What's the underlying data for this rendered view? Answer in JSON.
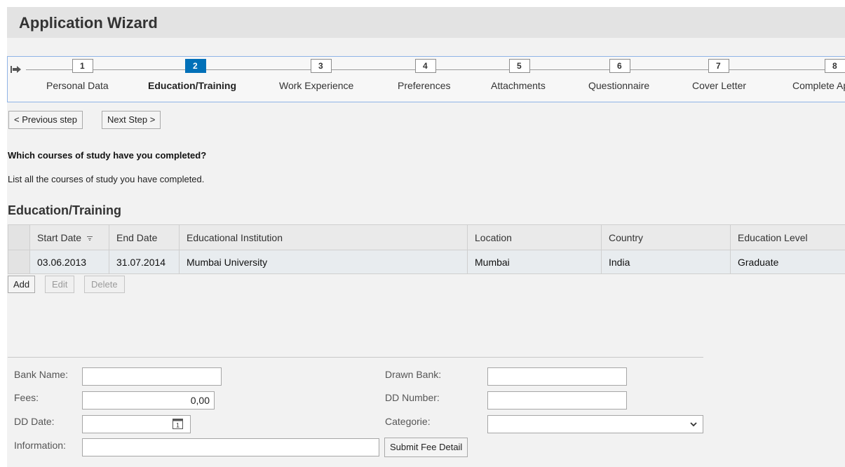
{
  "header": {
    "title": "Application Wizard"
  },
  "roadmap": {
    "steps": [
      {
        "number": "1",
        "label": "Personal Data"
      },
      {
        "number": "2",
        "label": "Education/Training",
        "active": true
      },
      {
        "number": "3",
        "label": "Work Experience"
      },
      {
        "number": "4",
        "label": "Preferences"
      },
      {
        "number": "5",
        "label": "Attachments"
      },
      {
        "number": "6",
        "label": "Questionnaire"
      },
      {
        "number": "7",
        "label": "Cover Letter"
      },
      {
        "number": "8",
        "label": "Complete Ap"
      }
    ],
    "active_color": "#0070b8"
  },
  "nav": {
    "previous_label": "< Previous step",
    "next_label": "Next Step >"
  },
  "content": {
    "question": "Which courses of study have you completed?",
    "instruction": "List all the courses of study you have completed.",
    "section_title": "Education/Training"
  },
  "table": {
    "columns": [
      "Start Date",
      "End Date",
      "Educational Institution",
      "Location",
      "Country",
      "Education Level"
    ],
    "rows": [
      [
        "03.06.2013",
        "31.07.2014",
        "Mumbai University",
        "Mumbai",
        "India",
        "Graduate"
      ]
    ]
  },
  "table_actions": {
    "add": "Add",
    "edit": "Edit",
    "delete": "Delete"
  },
  "fee_form": {
    "bank_name_label": "Bank Name:",
    "bank_name_value": "",
    "fees_label": "Fees:",
    "fees_value": "0,00",
    "dd_date_label": "DD Date:",
    "dd_date_value": "",
    "information_label": "Information:",
    "information_value": "",
    "drawn_bank_label": "Drawn Bank:",
    "drawn_bank_value": "",
    "dd_number_label": "DD Number:",
    "dd_number_value": "",
    "categorie_label": "Categorie:",
    "categorie_value": "",
    "submit_label": "Submit Fee Detail",
    "calendar_day": "1"
  }
}
